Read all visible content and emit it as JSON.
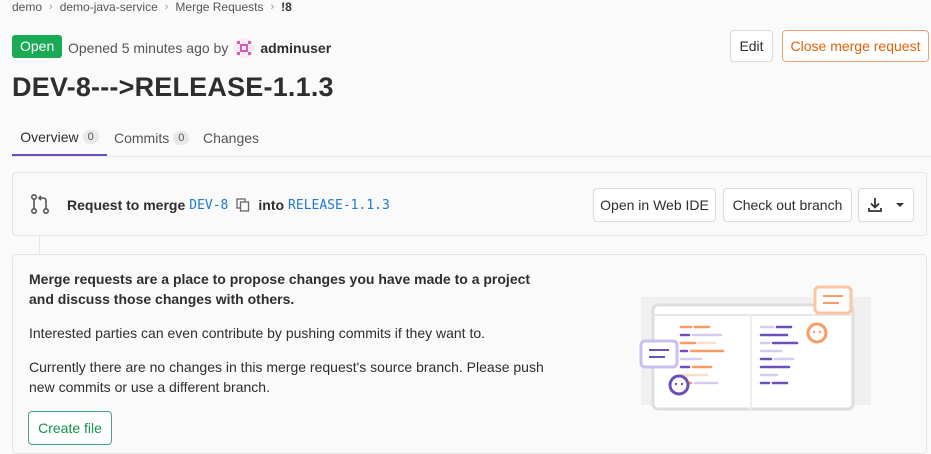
{
  "breadcrumb": {
    "items": [
      "demo",
      "demo-java-service",
      "Merge Requests",
      "!8"
    ]
  },
  "header": {
    "status": "Open",
    "opened_text": "Opened 5 minutes ago by",
    "author": "adminuser",
    "edit_label": "Edit",
    "close_label": "Close merge request",
    "title": "DEV-8--->RELEASE-1.1.3"
  },
  "tabs": [
    {
      "label": "Overview",
      "count": "0"
    },
    {
      "label": "Commits",
      "count": "0"
    },
    {
      "label": "Changes"
    }
  ],
  "merge_widget": {
    "request_label": "Request to merge",
    "source_branch": "DEV-8",
    "into_label": "into",
    "target_branch": "RELEASE-1.1.3",
    "web_ide_label": "Open in Web IDE",
    "checkout_label": "Check out branch",
    "icons": [
      "merge-request-icon",
      "copy-icon",
      "download-icon",
      "chevron-down-icon"
    ]
  },
  "empty_state": {
    "lead": "Merge requests are a place to propose changes you have made to a project and discuss those changes with others.",
    "paragraph1": "Interested parties can even contribute by pushing commits if they want to.",
    "paragraph2": "Currently there are no changes in this merge request's source branch. Please push new commits or use a different branch.",
    "create_file_label": "Create file"
  },
  "colors": {
    "status_green": "#1aaa55",
    "accent_purple": "#6b4fbb",
    "close_orange": "#e36209",
    "branch_blue": "#1f78d1"
  }
}
